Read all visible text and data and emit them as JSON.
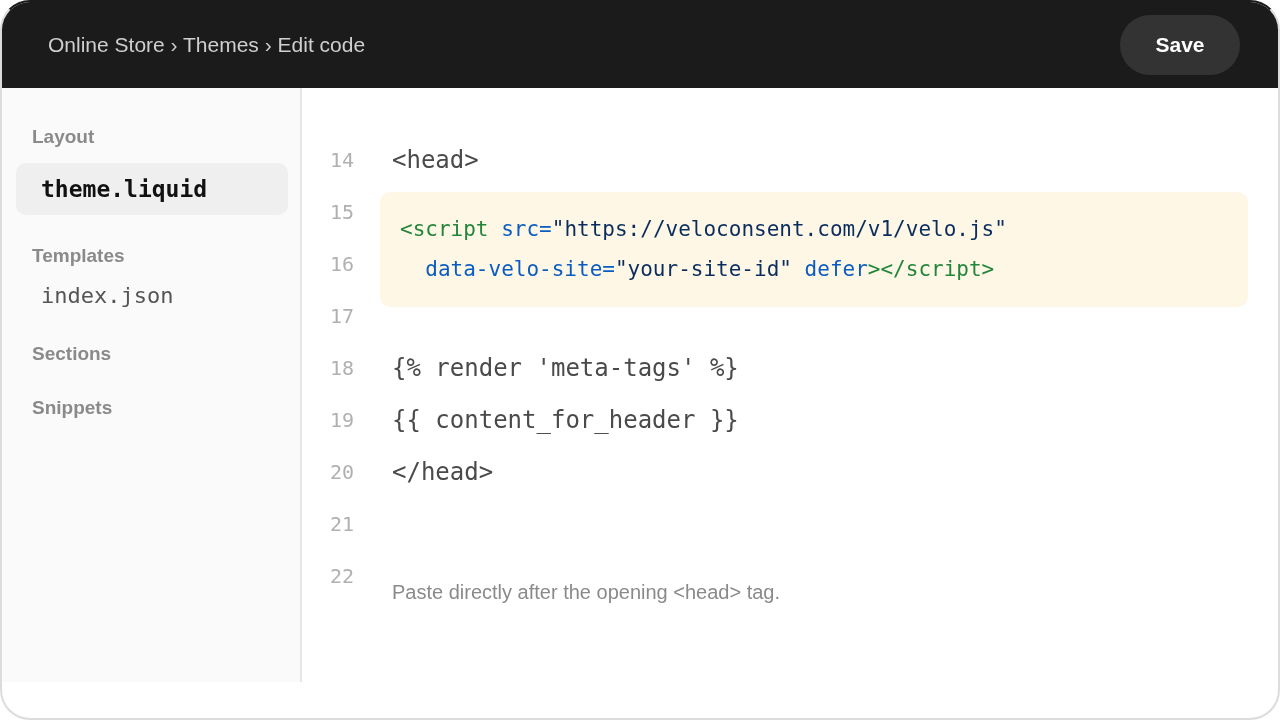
{
  "top_bar": {
    "breadcrumb": "Online Store › Themes › Edit code",
    "save_button": "Save"
  },
  "sidebar": {
    "groups": [
      {
        "heading": "Layout",
        "files": [
          {
            "name": "theme.liquid",
            "selected": true
          }
        ]
      },
      {
        "heading": "Templates",
        "files": [
          {
            "name": "index.json",
            "selected": false
          }
        ]
      },
      {
        "heading": "Sections"
      },
      {
        "heading": "Snippets"
      }
    ]
  },
  "editor": {
    "line_numbers": [
      "14",
      "15",
      "16",
      "17",
      "18",
      "19",
      "20",
      "21",
      "22"
    ],
    "blocks": [
      {
        "kind": "code",
        "text": "<head>"
      },
      {
        "kind": "snippet",
        "lines": [
          {
            "tokens": [
              {
                "kind": "tag",
                "text": "<script"
              },
              {
                "kind": "attr",
                "text": " src="
              },
              {
                "kind": "string",
                "text": "\"https://veloconsent.com/v1/velo.js\""
              }
            ]
          },
          {
            "tokens": [
              {
                "kind": "attr",
                "text": "  data-velo-site="
              },
              {
                "kind": "string",
                "text": "\"your-site-id\""
              },
              {
                "kind": "attr",
                "text": " defer"
              },
              {
                "kind": "tag",
                "text": "></script>"
              }
            ]
          }
        ]
      },
      {
        "kind": "code",
        "text": "{% render 'meta-tags' %}"
      },
      {
        "kind": "code",
        "text": "{{ content_for_header }}"
      },
      {
        "kind": "code",
        "text": "</head>"
      },
      {
        "kind": "note",
        "text": "Paste directly after the opening <head> tag."
      }
    ]
  }
}
